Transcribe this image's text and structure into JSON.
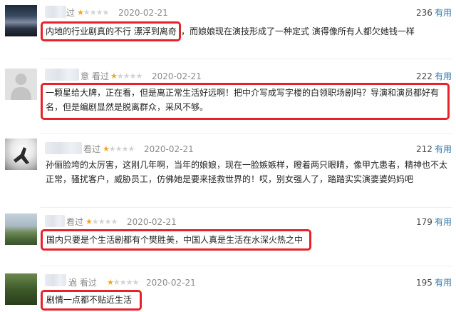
{
  "reviews": [
    {
      "user_suffix": "过",
      "rating": 1,
      "date": "2020-02-21",
      "useful_count": "236",
      "useful_label": "有用",
      "highlight": "内地的行业剧真的不行 漂浮到离奇",
      "text": "，而娘娘现在演技形成了一种定式 演得像所有人都欠她钱一样"
    },
    {
      "user_suffix": "意 看过",
      "rating": 1,
      "date": "2020-02-21",
      "useful_count": "222",
      "useful_label": "有用",
      "text": "一颗星给大牌，正在看，但是离正常生活好远啊！把中介写成写字楼的白领职场剧吗？导演和演员都好有名，但是编剧显然是脱离群众，采风不够。"
    },
    {
      "user_suffix": "看过",
      "rating": 1,
      "date": "2020-02-21",
      "useful_count": "212",
      "useful_label": "有用",
      "text": "孙俪脸垮的太厉害，这刚几年啊，当年的娘娘，现在一脸嫉嫉样，瞪着两只眼睛，像甲亢患者，精神也不太正常，骚扰客户，威胁员工，仿佛她是要来拯救世界的！哎，别女强人了，踏踏实实演婆婆妈妈吧"
    },
    {
      "user_suffix": "看过",
      "rating": 1,
      "date": "2020-02-21",
      "useful_count": "179",
      "useful_label": "有用",
      "text": "国内只要是个生活剧都有个樊胜美，中国人真是生活在水深火热之中"
    },
    {
      "user_suffix": "過 看过",
      "rating": 1,
      "date": "2020-02-21",
      "useful_count": "195",
      "useful_label": "有用",
      "text": "剧情一点都不贴近生活"
    }
  ],
  "colors": {
    "highlight_border": "#e8222a",
    "star_on": "#f4a316",
    "star_off": "#d2d2d2",
    "useful_link": "#3377aa"
  }
}
